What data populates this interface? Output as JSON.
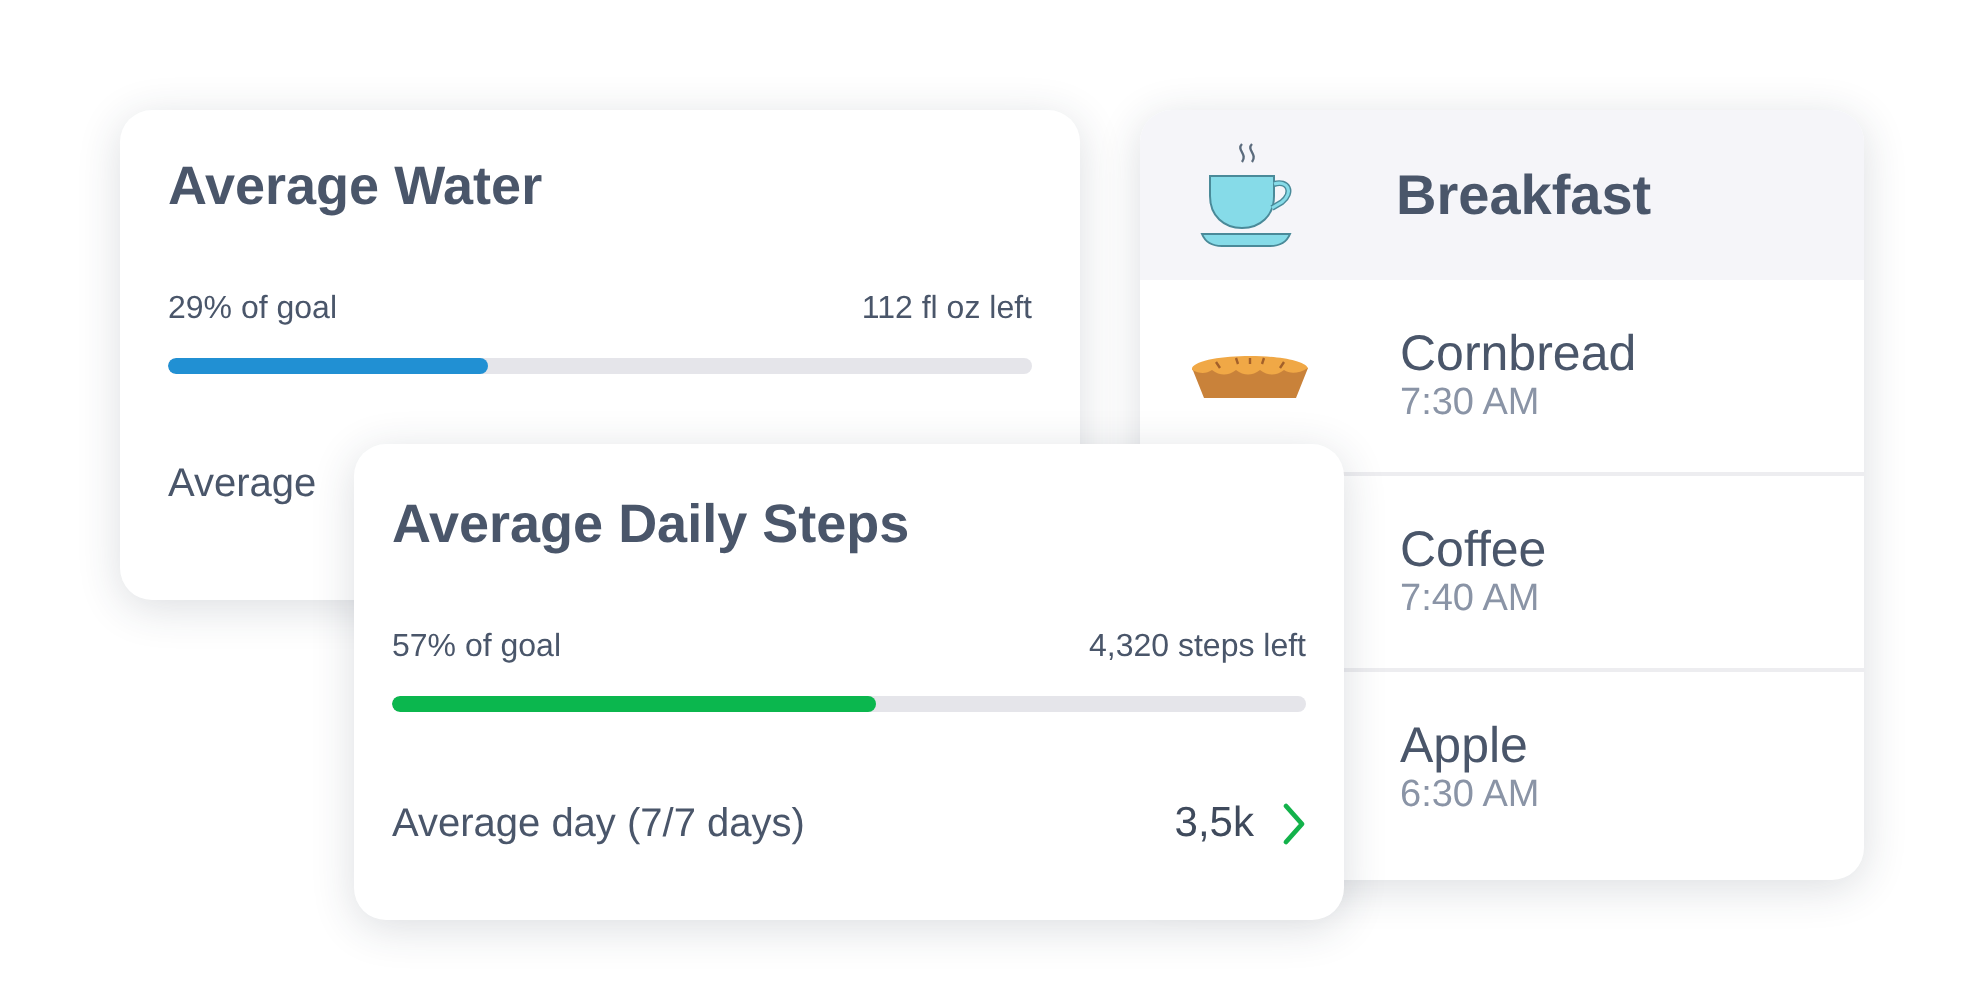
{
  "water_card": {
    "title": "Average Water",
    "progress_label": "29% of goal",
    "remaining": "112 fl oz left",
    "level": 0.37,
    "footer_label": "Average"
  },
  "steps_card": {
    "title": "Average Daily Steps",
    "progress_label": "57% of goal",
    "remaining": "4,320 steps left",
    "level": 0.53,
    "footer_label": "Average day (7/7 days)",
    "footer_value": "3,5k"
  },
  "meal_card": {
    "title": "Breakfast",
    "items": [
      {
        "name": "Cornbread",
        "time": "7:30 AM",
        "kind": "pie"
      },
      {
        "name": "Coffee",
        "time": "7:40 AM"
      },
      {
        "name": "Apple",
        "time": "6:30 AM"
      }
    ]
  }
}
